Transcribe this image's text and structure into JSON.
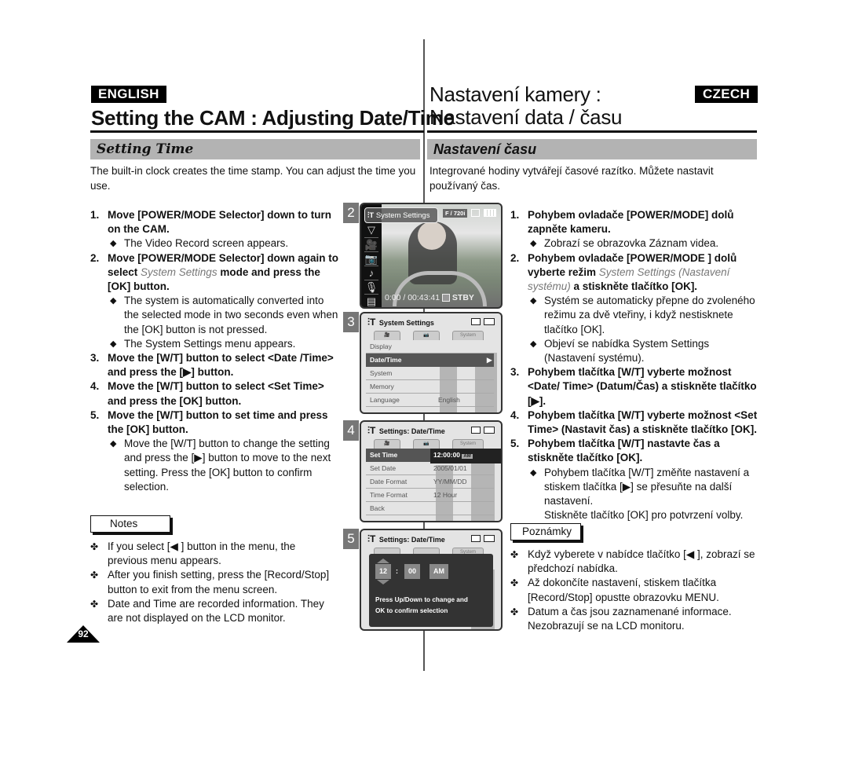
{
  "header": {
    "english_badge": "ENGLISH",
    "czech_badge": "CZECH",
    "title_en": "Setting the CAM : Adjusting Date/Time",
    "title_cz_line1": "Nastavení kamery :",
    "title_cz_line2": "Nastavení data / času"
  },
  "section": {
    "heading_en": "Setting Time",
    "heading_cz": "Nastavení času",
    "intro_en": "The built-in clock creates the time stamp. You can adjust the time you use.",
    "intro_cz": "Integrované hodiny vytvářejí časové razítko. Můžete nastavit používaný čas."
  },
  "steps_en": [
    {
      "num": "1.",
      "text": "Move [POWER/MODE Selector] down to turn on the CAM.",
      "subs": [
        "The Video Record screen appears."
      ]
    },
    {
      "num": "2.",
      "text_a": "Move [POWER/MODE Selector] down again to select ",
      "text_em": "System Settings",
      "text_b": " mode and press the [OK] button.",
      "subs": [
        "The system is automatically converted into the selected mode in two seconds even when the [OK] button is not pressed.",
        "The System Settings menu appears."
      ]
    },
    {
      "num": "3.",
      "text": "Move the [W/T] button to select <Date /Time> and press the [▶] button."
    },
    {
      "num": "4.",
      "text": "Move the [W/T] button to select <Set Time> and press the [OK] button."
    },
    {
      "num": "5.",
      "text": "Move the [W/T] button to set time and press the [OK] button.",
      "subs": [
        "Move the [W/T] button to change the setting and press the [▶] button to move to the next setting. Press the [OK] button to confirm selection."
      ]
    }
  ],
  "steps_cz": [
    {
      "num": "1.",
      "text": "Pohybem ovladače [POWER/MODE] dolů zapněte kameru.",
      "subs": [
        "Zobrazí se obrazovka Záznam videa."
      ]
    },
    {
      "num": "2.",
      "text_a": "Pohybem ovladače [POWER/MODE ] dolů vyberte režim ",
      "text_em": "System Settings (Nastavení systému)",
      "text_b": " a stiskněte tlačítko [OK].",
      "subs": [
        "Systém se automaticky přepne do zvoleného režimu za dvě vteřiny, i když nestisknete tlačítko [OK].",
        "Objeví se nabídka System Settings (Nastavení systému)."
      ]
    },
    {
      "num": "3.",
      "text": "Pohybem tlačítka [W/T] vyberte možnost <Date/ Time> (Datum/Čas) a stiskněte tlačítko [▶]."
    },
    {
      "num": "4.",
      "text": "Pohybem tlačítka [W/T] vyberte možnost <Set Time> (Nastavit čas) a stiskněte tlačítko [OK]."
    },
    {
      "num": "5.",
      "text": "Pohybem tlačítka [W/T] nastavte čas a stiskněte tlačítko [OK].",
      "subs": [
        "Pohybem tlačítka [W/T] změňte nastavení a stiskem tlačítka [▶] se přesuňte na další nastavení."
      ],
      "cont": "Stiskněte tlačítko [OK] pro potvrzení volby."
    }
  ],
  "notes_en": {
    "label": "Notes",
    "items": [
      "If you select [◀ ] button in the menu, the previous menu appears.",
      "After you finish setting, press the [Record/Stop] button to exit from the menu screen.",
      "Date and Time are recorded information. They are not displayed on the LCD monitor."
    ]
  },
  "notes_cz": {
    "label": "Poznámky",
    "items": [
      "Když vyberete v nabídce tlačítko [◀ ], zobrazí se předchozí nabídka.",
      "Až dokončíte nastavení, stiskem tlačítka [Record/Stop] opustte obrazovku MENU.",
      "Datum a čas jsou zaznamenané informace. Nezobrazují se na LCD monitoru."
    ]
  },
  "page_number": "92",
  "screens": {
    "s2": {
      "step": "2",
      "mode_label": "System Settings",
      "resolution": "F / 720i",
      "counter": "0:00 / 00:43:41",
      "status": "STBY",
      "side_icons": [
        "down-arrow",
        "video-camera",
        "photo-camera",
        "music-note",
        "voice-mic",
        "document"
      ]
    },
    "s3": {
      "step": "3",
      "title": "System Settings",
      "tabs": [
        "🎥",
        "📷",
        "System"
      ],
      "rows": [
        {
          "label": "Display",
          "value": ""
        },
        {
          "label": "Date/Time",
          "value": "▶",
          "selected": true
        },
        {
          "label": "System",
          "value": ""
        },
        {
          "label": "Memory",
          "value": ""
        },
        {
          "label": "Language",
          "value": "English"
        }
      ]
    },
    "s4": {
      "step": "4",
      "title": "Settings: Date/Time",
      "tabs": [
        "🎥",
        "📷",
        "System"
      ],
      "rows": [
        {
          "label": "Set Time",
          "value": "12:00:00",
          "badge": "AM",
          "selected": true
        },
        {
          "label": "Set Date",
          "value": "2005/01/01"
        },
        {
          "label": "Date Format",
          "value": "YY/MM/DD"
        },
        {
          "label": "Time Format",
          "value": "12 Hour"
        },
        {
          "label": "Back",
          "value": ""
        }
      ]
    },
    "s5": {
      "step": "5",
      "title": "Settings: Date/Time",
      "tab_system": "System",
      "hour": "12",
      "sep": ":",
      "minute": "00",
      "ampm": "AM",
      "message_line1": "Press Up/Down to change and",
      "message_line2": "OK to confirm selection"
    }
  }
}
